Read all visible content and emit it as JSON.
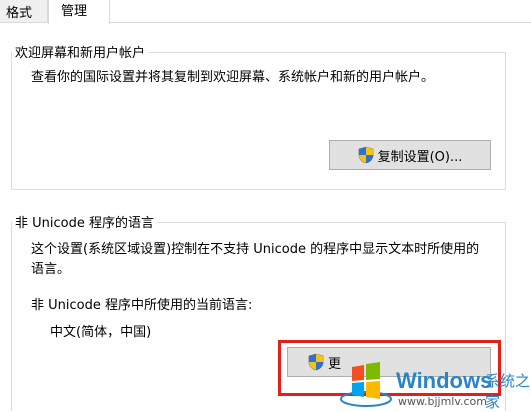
{
  "tabs": [
    {
      "label": "格式",
      "active": false
    },
    {
      "label": "管理",
      "active": true
    }
  ],
  "welcome_group": {
    "title": "欢迎屏幕和新用户帐户",
    "description": "查看你的国际设置并将其复制到欢迎屏幕、系统帐户和新的用户帐户。",
    "copy_button_label": "复制设置(O)..."
  },
  "unicode_group": {
    "title": "非 Unicode 程序的语言",
    "description": "这个设置(系统区域设置)控制在不支持 Unicode 的程序中显示文本时所使用的语言。",
    "current_label": "非 Unicode 程序中所使用的当前语言:",
    "current_value": "中文(简体，中国)",
    "change_button_label": "更"
  },
  "watermark": {
    "brand": "Windows",
    "brand_cn": "系统之家",
    "url": "www.bjjmlv.com"
  },
  "colors": {
    "highlight": "#e0201b",
    "watermark_blue": "#2a84c8"
  },
  "icons": {
    "shield": "uac-shield-icon",
    "windows_logo": "windows-logo-icon"
  }
}
